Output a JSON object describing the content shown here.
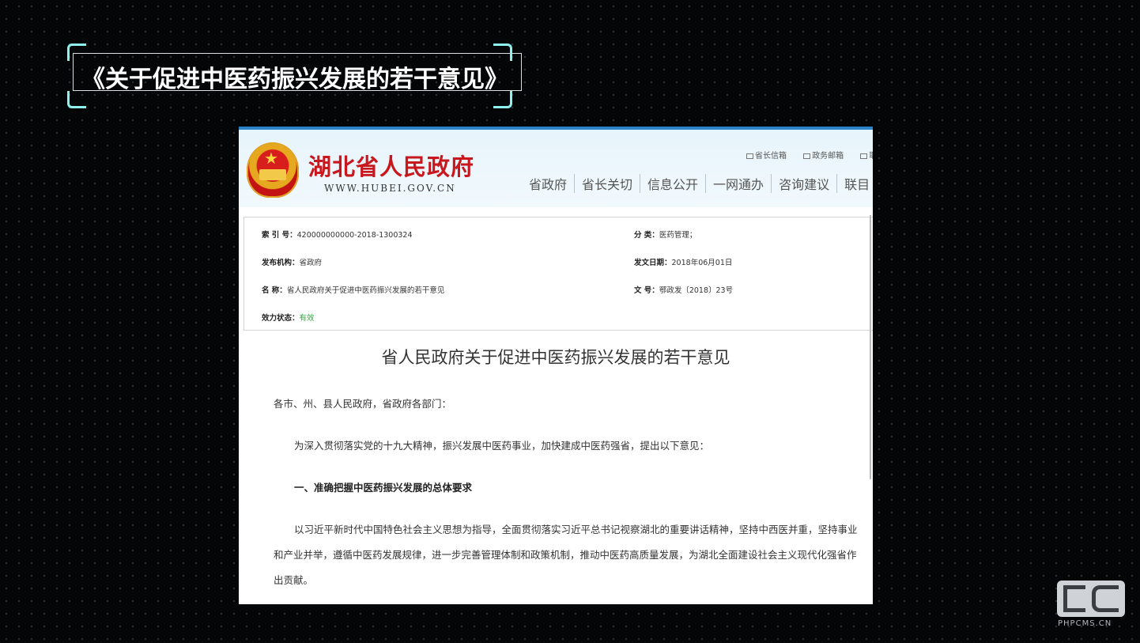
{
  "slide": {
    "title": "《关于促进中医药振兴发展的若干意见》",
    "accent_color": "#8ff1ee"
  },
  "site": {
    "name": "湖北省人民政府",
    "url": "WWW.HUBEI.GOV.CN",
    "emblem_icon": "national-emblem",
    "top_links": [
      "省长信箱",
      "政务邮箱",
      "取"
    ],
    "nav": [
      "省政府",
      "省长关切",
      "信息公开",
      "一网通办",
      "咨询建议",
      "联目"
    ],
    "brand_color": "#c8171d"
  },
  "info": {
    "index_label": "索 引 号：",
    "index_value": "420000000000-2018-1300324",
    "category_label": "分 类：",
    "category_value": "医药管理；",
    "publisher_label": "发布机构：",
    "publisher_value": "省政府",
    "date_label": "发文日期：",
    "date_value": "2018年06月01日",
    "name_label": "名 称：",
    "name_value": "省人民政府关于促进中医药振兴发展的若干意见",
    "docno_label": "文 号：",
    "docno_value": "鄂政发〔2018〕23号",
    "status_label": "效力状态：",
    "status_value": "有效"
  },
  "document": {
    "title": "省人民政府关于促进中医药振兴发展的若干意见",
    "salutation": "各市、州、县人民政府，省政府各部门：",
    "intro": "为深入贯彻落实党的十九大精神，振兴发展中医药事业，加快建成中医药强省，提出以下意见：",
    "section1_heading": "一、准确把握中医药振兴发展的总体要求",
    "section1_line1": "以习近平新时代中国特色社会主义思想为指导，全面贯彻落实习近平总书记视察湖北的重要讲话精神，坚持中西医并重，坚持事业",
    "section1_line2": "和产业并举，遵循中医药发展规律，进一步完善管理体制和政策机制，推动中医药高质量发展，为湖北全面建设社会主义现代化强省作",
    "section1_line3": "出贡献。"
  },
  "watermark": {
    "text": "PHPCMS.CN"
  }
}
